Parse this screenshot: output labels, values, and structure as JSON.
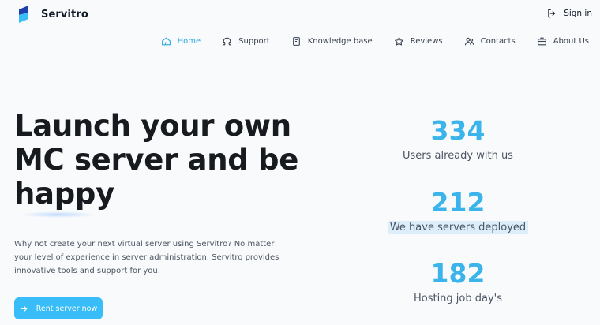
{
  "brand": {
    "name": "Servitro"
  },
  "header": {
    "signin_label": "Sign in"
  },
  "nav": {
    "items": [
      {
        "label": "Home",
        "icon": "home-icon",
        "active": true
      },
      {
        "label": "Support",
        "icon": "headset-icon"
      },
      {
        "label": "Knowledge base",
        "icon": "book-icon"
      },
      {
        "label": "Reviews",
        "icon": "star-icon"
      },
      {
        "label": "Contacts",
        "icon": "users-icon"
      },
      {
        "label": "About Us",
        "icon": "briefcase-icon"
      }
    ]
  },
  "hero": {
    "title_line1": "Launch your own",
    "title_line2": "MC server and be",
    "title_line3": "happy",
    "description": "Why not create your next virtual server using Servitro? No matter your level of experience in server administration, Servitro provides innovative tools and support for you.",
    "cta_label": "Rent server now"
  },
  "stats": [
    {
      "value": "334",
      "label": "Users already with us"
    },
    {
      "value": "212",
      "label": "We have servers deployed"
    },
    {
      "value": "182",
      "label": "Hosting job day's"
    }
  ],
  "colors": {
    "accent": "#38bdf8",
    "stat_value": "#3ab4ea",
    "active_nav": "#2ba8e0"
  }
}
